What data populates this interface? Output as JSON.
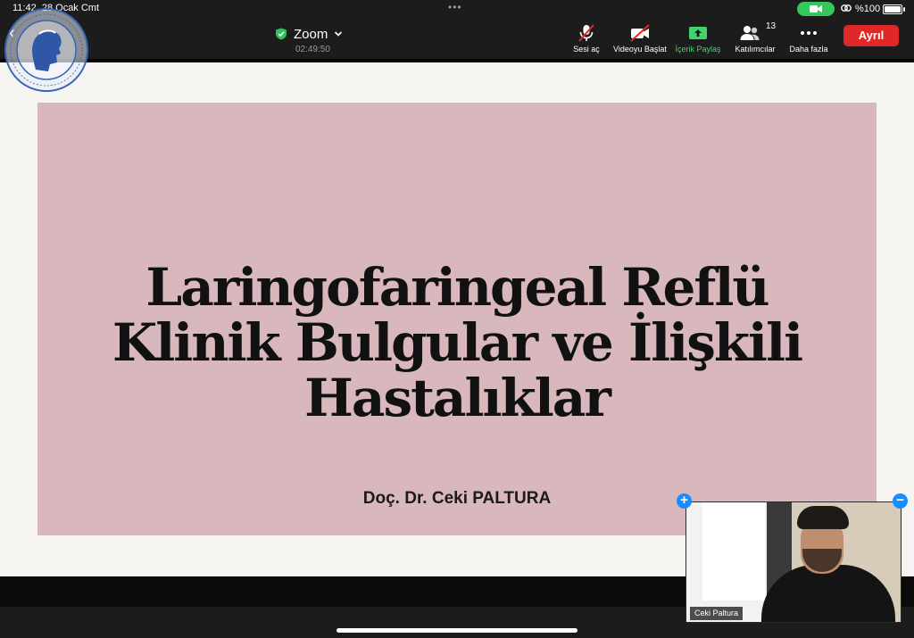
{
  "status_bar": {
    "time": "11:42",
    "date": "28 Ocak Cmt",
    "battery": "%100"
  },
  "meeting": {
    "app_name": "Zoom",
    "timer": "02:49:50"
  },
  "toolbar": {
    "unmute_label": "Sesi aç",
    "start_video_label": "Videoyu Başlat",
    "share_label": "İçerik Paylaş",
    "participants_label": "Katılımcılar",
    "participants_count": "13",
    "more_label": "Daha fazla",
    "leave_label": "Ayrıl"
  },
  "slide": {
    "title_lines": [
      "Laringofaringeal Reflü",
      "Klinik Bulgular ve İlişkili",
      "Hastalıklar"
    ],
    "author": "Doç. Dr. Ceki PALTURA"
  },
  "video_tile": {
    "name": "Ceki Paltura"
  },
  "colors": {
    "slide_background": "#d9b8bd",
    "leave_red": "#e02828",
    "share_green": "#3fd56b",
    "camera_pill_green": "#34c759",
    "accent_blue": "#1a8cff"
  }
}
